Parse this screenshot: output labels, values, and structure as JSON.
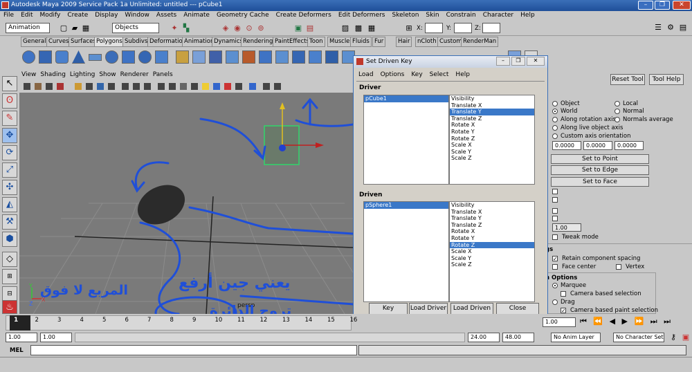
{
  "window": {
    "title": "Autodesk Maya 2009 Service Pack 1a Unlimited: untitled   ---   pCube1",
    "min": "–",
    "max": "❐",
    "close": "✕"
  },
  "menubar": [
    "File",
    "Edit",
    "Modify",
    "Create",
    "Display",
    "Window",
    "Assets",
    "Animate",
    "Geometry Cache",
    "Create Deformers",
    "Edit Deformers",
    "Skeleton",
    "Skin",
    "Constrain",
    "Character",
    "Help"
  ],
  "statusline": {
    "menu_set": "Animation",
    "select_by": "Objects",
    "x_label": "X:",
    "y_label": "Y:",
    "z_label": "Z:"
  },
  "shelf_tabs": [
    "General",
    "Curves",
    "Surfaces",
    "Polygons",
    "Subdivs",
    "Deformation",
    "Animation",
    "Dynamics",
    "Rendering",
    "PaintEffects",
    "Toon",
    "Muscle",
    "Fluids",
    "Fur",
    "Hair",
    "nCloth",
    "Custom",
    "RenderMan"
  ],
  "shelf_active": "Polygons",
  "viewport": {
    "menu": [
      "View",
      "Shading",
      "Lighting",
      "Show",
      "Renderer",
      "Panels"
    ],
    "camera_label": "persp"
  },
  "timeline": {
    "ticks": [
      "1",
      "2",
      "3",
      "4",
      "5",
      "6",
      "7",
      "8",
      "9",
      "10",
      "11",
      "12",
      "13",
      "14",
      "15",
      "16"
    ],
    "current": "1",
    "current_frame": "1.00"
  },
  "range": {
    "start": "1.00",
    "start2": "1.00",
    "end": "24.00",
    "end2": "48.00",
    "anim_layer": "No Anim Layer",
    "char_set": "No Character Set"
  },
  "cmdline": {
    "label": "MEL"
  },
  "toolsettings": {
    "reset": "Reset Tool",
    "help": "Tool Help",
    "options": [
      "Object",
      "World",
      "Along rotation axis",
      "Along live object axis",
      "Custom axis orientation"
    ],
    "options_right": [
      "Local",
      "Normal",
      "Normals average"
    ],
    "values": [
      "0.0000",
      "0.0000",
      "0.0000"
    ],
    "set_point": "Set to Point",
    "set_edge": "Set to Edge",
    "set_face": "Set to Face",
    "step": "1.00",
    "tweak": "Tweak mode",
    "gs_label": "gs",
    "retain": "Retain component spacing",
    "face_center": "Face center",
    "vertex": "Vertex",
    "sel_options": "n Options",
    "marquee": "Marquee",
    "camera_sel": "Camera based selection",
    "drag": "Drag",
    "camera_paint": "Camera based paint selection"
  },
  "sdk": {
    "title": "Set Driven Key",
    "menu": [
      "Load",
      "Options",
      "Key",
      "Select",
      "Help"
    ],
    "driver_label": "Driver",
    "driven_label": "Driven",
    "driver_object": "pCube1",
    "driven_object": "pSphere1",
    "attributes": [
      "Visibility",
      "Translate X",
      "Translate Y",
      "Translate Z",
      "Rotate X",
      "Rotate Y",
      "Rotate Z",
      "Scale X",
      "Scale Y",
      "Scale Z"
    ],
    "driver_selected": 2,
    "driven_selected": 6,
    "buttons": {
      "key": "Key",
      "load_driver": "Load Driver",
      "load_driven": "Load Driven",
      "close": "Close"
    }
  },
  "annotations": {
    "line1": "يعني جين أرفع",
    "line2": "المربع لا فوق",
    "line3": "تروح الدائرة"
  },
  "colors": {
    "accent": "#3a78c8",
    "annotation": "#1f4fd8",
    "viewport": "#7a7a7a"
  }
}
